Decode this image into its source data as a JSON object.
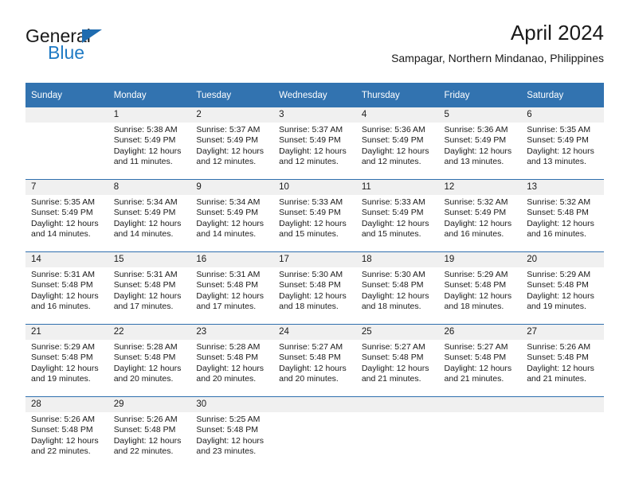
{
  "brand": {
    "name_top": "General",
    "name_bottom": "Blue",
    "color_blue": "#1f7ac4",
    "triangle_color": "#1f6cb0"
  },
  "header": {
    "title": "April 2024",
    "subtitle": "Sampagar, Northern Mindanao, Philippines"
  },
  "theme": {
    "header_bar": "#3273b0",
    "row_divider": "#2f6fae",
    "daynum_band": "#f0f0f0",
    "text": "#1a1a1a"
  },
  "weekday_headers": [
    "Sunday",
    "Monday",
    "Tuesday",
    "Wednesday",
    "Thursday",
    "Friday",
    "Saturday"
  ],
  "labels": {
    "sunrise_prefix": "Sunrise: ",
    "sunset_prefix": "Sunset: ",
    "daylight_prefix": "Daylight: "
  },
  "weeks": [
    [
      {
        "day": "",
        "l1": "",
        "l2": "",
        "l3": "",
        "l4": ""
      },
      {
        "day": "1",
        "l1": "Sunrise: 5:38 AM",
        "l2": "Sunset: 5:49 PM",
        "l3": "Daylight: 12 hours",
        "l4": "and 11 minutes."
      },
      {
        "day": "2",
        "l1": "Sunrise: 5:37 AM",
        "l2": "Sunset: 5:49 PM",
        "l3": "Daylight: 12 hours",
        "l4": "and 12 minutes."
      },
      {
        "day": "3",
        "l1": "Sunrise: 5:37 AM",
        "l2": "Sunset: 5:49 PM",
        "l3": "Daylight: 12 hours",
        "l4": "and 12 minutes."
      },
      {
        "day": "4",
        "l1": "Sunrise: 5:36 AM",
        "l2": "Sunset: 5:49 PM",
        "l3": "Daylight: 12 hours",
        "l4": "and 12 minutes."
      },
      {
        "day": "5",
        "l1": "Sunrise: 5:36 AM",
        "l2": "Sunset: 5:49 PM",
        "l3": "Daylight: 12 hours",
        "l4": "and 13 minutes."
      },
      {
        "day": "6",
        "l1": "Sunrise: 5:35 AM",
        "l2": "Sunset: 5:49 PM",
        "l3": "Daylight: 12 hours",
        "l4": "and 13 minutes."
      }
    ],
    [
      {
        "day": "7",
        "l1": "Sunrise: 5:35 AM",
        "l2": "Sunset: 5:49 PM",
        "l3": "Daylight: 12 hours",
        "l4": "and 14 minutes."
      },
      {
        "day": "8",
        "l1": "Sunrise: 5:34 AM",
        "l2": "Sunset: 5:49 PM",
        "l3": "Daylight: 12 hours",
        "l4": "and 14 minutes."
      },
      {
        "day": "9",
        "l1": "Sunrise: 5:34 AM",
        "l2": "Sunset: 5:49 PM",
        "l3": "Daylight: 12 hours",
        "l4": "and 14 minutes."
      },
      {
        "day": "10",
        "l1": "Sunrise: 5:33 AM",
        "l2": "Sunset: 5:49 PM",
        "l3": "Daylight: 12 hours",
        "l4": "and 15 minutes."
      },
      {
        "day": "11",
        "l1": "Sunrise: 5:33 AM",
        "l2": "Sunset: 5:49 PM",
        "l3": "Daylight: 12 hours",
        "l4": "and 15 minutes."
      },
      {
        "day": "12",
        "l1": "Sunrise: 5:32 AM",
        "l2": "Sunset: 5:49 PM",
        "l3": "Daylight: 12 hours",
        "l4": "and 16 minutes."
      },
      {
        "day": "13",
        "l1": "Sunrise: 5:32 AM",
        "l2": "Sunset: 5:48 PM",
        "l3": "Daylight: 12 hours",
        "l4": "and 16 minutes."
      }
    ],
    [
      {
        "day": "14",
        "l1": "Sunrise: 5:31 AM",
        "l2": "Sunset: 5:48 PM",
        "l3": "Daylight: 12 hours",
        "l4": "and 16 minutes."
      },
      {
        "day": "15",
        "l1": "Sunrise: 5:31 AM",
        "l2": "Sunset: 5:48 PM",
        "l3": "Daylight: 12 hours",
        "l4": "and 17 minutes."
      },
      {
        "day": "16",
        "l1": "Sunrise: 5:31 AM",
        "l2": "Sunset: 5:48 PM",
        "l3": "Daylight: 12 hours",
        "l4": "and 17 minutes."
      },
      {
        "day": "17",
        "l1": "Sunrise: 5:30 AM",
        "l2": "Sunset: 5:48 PM",
        "l3": "Daylight: 12 hours",
        "l4": "and 18 minutes."
      },
      {
        "day": "18",
        "l1": "Sunrise: 5:30 AM",
        "l2": "Sunset: 5:48 PM",
        "l3": "Daylight: 12 hours",
        "l4": "and 18 minutes."
      },
      {
        "day": "19",
        "l1": "Sunrise: 5:29 AM",
        "l2": "Sunset: 5:48 PM",
        "l3": "Daylight: 12 hours",
        "l4": "and 18 minutes."
      },
      {
        "day": "20",
        "l1": "Sunrise: 5:29 AM",
        "l2": "Sunset: 5:48 PM",
        "l3": "Daylight: 12 hours",
        "l4": "and 19 minutes."
      }
    ],
    [
      {
        "day": "21",
        "l1": "Sunrise: 5:29 AM",
        "l2": "Sunset: 5:48 PM",
        "l3": "Daylight: 12 hours",
        "l4": "and 19 minutes."
      },
      {
        "day": "22",
        "l1": "Sunrise: 5:28 AM",
        "l2": "Sunset: 5:48 PM",
        "l3": "Daylight: 12 hours",
        "l4": "and 20 minutes."
      },
      {
        "day": "23",
        "l1": "Sunrise: 5:28 AM",
        "l2": "Sunset: 5:48 PM",
        "l3": "Daylight: 12 hours",
        "l4": "and 20 minutes."
      },
      {
        "day": "24",
        "l1": "Sunrise: 5:27 AM",
        "l2": "Sunset: 5:48 PM",
        "l3": "Daylight: 12 hours",
        "l4": "and 20 minutes."
      },
      {
        "day": "25",
        "l1": "Sunrise: 5:27 AM",
        "l2": "Sunset: 5:48 PM",
        "l3": "Daylight: 12 hours",
        "l4": "and 21 minutes."
      },
      {
        "day": "26",
        "l1": "Sunrise: 5:27 AM",
        "l2": "Sunset: 5:48 PM",
        "l3": "Daylight: 12 hours",
        "l4": "and 21 minutes."
      },
      {
        "day": "27",
        "l1": "Sunrise: 5:26 AM",
        "l2": "Sunset: 5:48 PM",
        "l3": "Daylight: 12 hours",
        "l4": "and 21 minutes."
      }
    ],
    [
      {
        "day": "28",
        "l1": "Sunrise: 5:26 AM",
        "l2": "Sunset: 5:48 PM",
        "l3": "Daylight: 12 hours",
        "l4": "and 22 minutes."
      },
      {
        "day": "29",
        "l1": "Sunrise: 5:26 AM",
        "l2": "Sunset: 5:48 PM",
        "l3": "Daylight: 12 hours",
        "l4": "and 22 minutes."
      },
      {
        "day": "30",
        "l1": "Sunrise: 5:25 AM",
        "l2": "Sunset: 5:48 PM",
        "l3": "Daylight: 12 hours",
        "l4": "and 23 minutes."
      },
      {
        "day": "",
        "l1": "",
        "l2": "",
        "l3": "",
        "l4": ""
      },
      {
        "day": "",
        "l1": "",
        "l2": "",
        "l3": "",
        "l4": ""
      },
      {
        "day": "",
        "l1": "",
        "l2": "",
        "l3": "",
        "l4": ""
      },
      {
        "day": "",
        "l1": "",
        "l2": "",
        "l3": "",
        "l4": ""
      }
    ]
  ]
}
